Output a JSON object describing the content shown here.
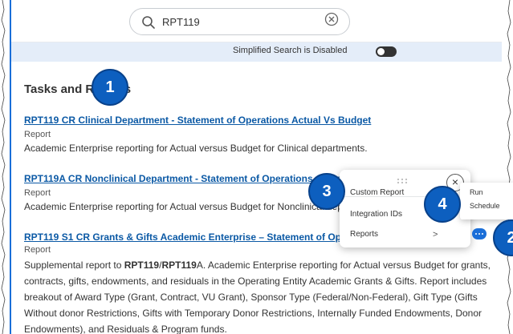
{
  "search": {
    "value": "RPT119",
    "placeholder": ""
  },
  "simplified_search": {
    "label": "Simplified Search is Disabled",
    "toggle_on": false
  },
  "section_heading": "Tasks and Reports",
  "results": [
    {
      "title": "RPT119 CR Clinical Department - Statement of Operations Actual Vs Budget",
      "type": "Report",
      "description": "Academic Enterprise reporting for Actual versus Budget for Clinical departments."
    },
    {
      "title": "RPT119A CR Nonclinical Department - Statement of Operations Actual Vs Budget",
      "type": "Report",
      "description": "Academic Enterprise reporting for Actual versus Budget for Nonclinical departments."
    },
    {
      "title": "RPT119 S1 CR Grants & Gifts Academic Enterprise – Statement of Operations Actual Vs Budget",
      "type": "Report",
      "description": {
        "lead": "Supplemental report to ",
        "code1": "RPT119",
        "slash": "/",
        "code2": "RPT119",
        "code2_suffix": "A",
        "rest": ". Academic Enterprise reporting for Actual versus Budget for grants, contracts, gifts, endowments, and residuals in the Operating Entity Academic Grants & Gifts. Report includes breakout of Award Type (Grant, Contract, VU Grant), Sponsor Type (Federal/Non-Federal), Gift Type (Gifts Without donor Restrictions, Gifts with Temporary Donor Restrictions, Internally Funded Endowments, Donor Endowments), and Residuals & Program funds."
      }
    }
  ],
  "related_actions_menu": {
    "items": [
      "Custom Report",
      "Integration IDs",
      "Reports"
    ],
    "reports_chevron": ">",
    "close_symbol": "×"
  },
  "reports_submenu": {
    "items": [
      "Run",
      "Schedule"
    ]
  },
  "callouts": [
    "1",
    "2",
    "3",
    "4"
  ],
  "colors": {
    "link": "#0b59a5",
    "callout": "#0d5fbf",
    "simplified_bar": "#e4edf9",
    "related_button": "#1a6ed8"
  },
  "icons": [
    "search-icon",
    "clear-search-icon",
    "drag-grip-icon",
    "close-icon",
    "chevron-right-icon",
    "more-actions-icon"
  ]
}
